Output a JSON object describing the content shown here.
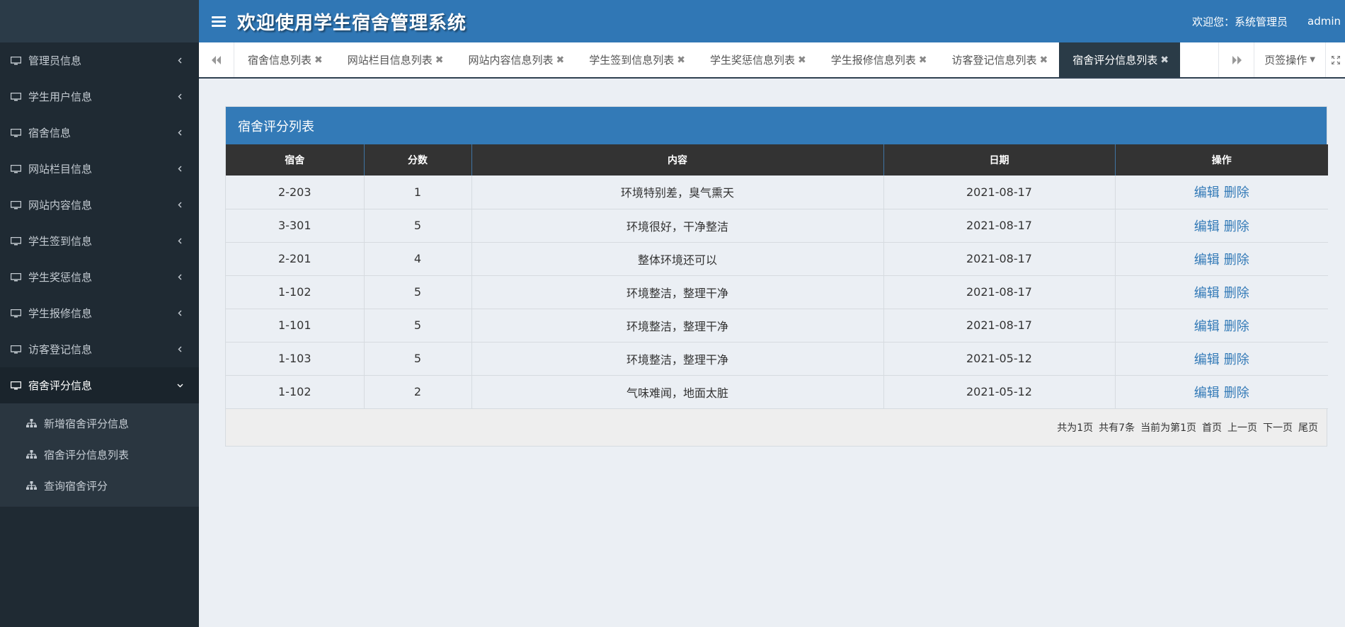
{
  "app": {
    "title": "欢迎使用学生宿舍管理系统",
    "welcome": "欢迎您：系统管理员",
    "user": "admin"
  },
  "sidebar": {
    "items": [
      {
        "label": "管理员信息"
      },
      {
        "label": "学生用户信息"
      },
      {
        "label": "宿舍信息"
      },
      {
        "label": "网站栏目信息"
      },
      {
        "label": "网站内容信息"
      },
      {
        "label": "学生签到信息"
      },
      {
        "label": "学生奖惩信息"
      },
      {
        "label": "学生报修信息"
      },
      {
        "label": "访客登记信息"
      },
      {
        "label": "宿舍评分信息"
      }
    ],
    "subitems": [
      {
        "label": "新增宿舍评分信息"
      },
      {
        "label": "宿舍评分信息列表"
      },
      {
        "label": "查询宿舍评分"
      }
    ]
  },
  "tabs": {
    "items": [
      {
        "label": "宿舍信息列表"
      },
      {
        "label": "网站栏目信息列表"
      },
      {
        "label": "网站内容信息列表"
      },
      {
        "label": "学生签到信息列表"
      },
      {
        "label": "学生奖惩信息列表"
      },
      {
        "label": "学生报修信息列表"
      },
      {
        "label": "访客登记信息列表"
      },
      {
        "label": "宿舍评分信息列表"
      }
    ],
    "ops_label": "页签操作"
  },
  "panel": {
    "title": "宿舍评分列表",
    "columns": [
      "宿舍",
      "分数",
      "内容",
      "日期",
      "操作"
    ],
    "rows": [
      {
        "dorm": "2-203",
        "score": "1",
        "content": "环境特别差，臭气熏天",
        "date": "2021-08-17"
      },
      {
        "dorm": "3-301",
        "score": "5",
        "content": "环境很好，干净整洁",
        "date": "2021-08-17"
      },
      {
        "dorm": "2-201",
        "score": "4",
        "content": "整体环境还可以",
        "date": "2021-08-17"
      },
      {
        "dorm": "1-102",
        "score": "5",
        "content": "环境整洁，整理干净",
        "date": "2021-08-17"
      },
      {
        "dorm": "1-101",
        "score": "5",
        "content": "环境整洁，整理干净",
        "date": "2021-08-17"
      },
      {
        "dorm": "1-103",
        "score": "5",
        "content": "环境整洁，整理干净",
        "date": "2021-05-12"
      },
      {
        "dorm": "1-102",
        "score": "2",
        "content": "气味难闻，地面太脏",
        "date": "2021-05-12"
      }
    ],
    "edit_label": "编辑",
    "delete_label": "删除"
  },
  "pager": {
    "total_pages": "共为1页",
    "total_count": "共有7条",
    "current": "当前为第1页",
    "first": "首页",
    "prev": "上一页",
    "next": "下一页",
    "last": "尾页"
  }
}
